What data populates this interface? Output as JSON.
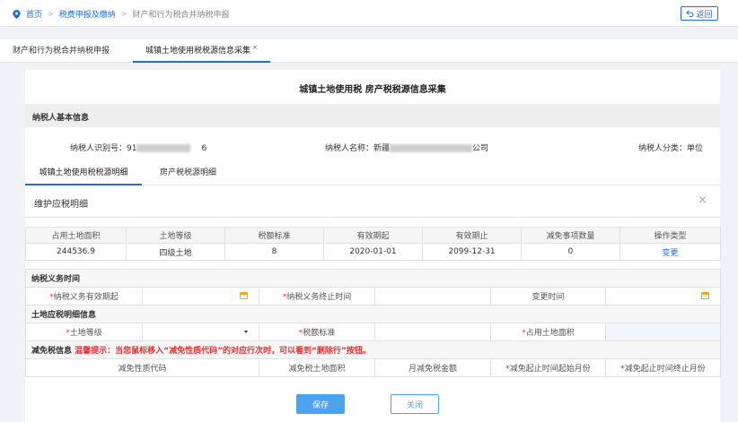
{
  "breadcrumb": {
    "home": "首页",
    "level2": "税费申报及缴纳",
    "level3": "财产和行为税合并纳税申报",
    "back_label": "返回"
  },
  "tabs": [
    {
      "label": "财产和行为税合并纳税申报"
    },
    {
      "label": "城镇土地使用税税源信息采集",
      "close": "×"
    }
  ],
  "page_title": "城镇土地使用税 房产税税源信息采集",
  "taxpayer_section": {
    "title": "纳税人基本信息",
    "id_label": "纳税人识别号：",
    "id_value_prefix": "91",
    "id_value_suffix": "6",
    "name_label": "纳税人名称：",
    "name_value_prefix": "新疆",
    "name_value_suffix": "公司",
    "type_label": "纳税人分类：",
    "type_value": "单位"
  },
  "sub_tabs": [
    "城镇土地使用税税源明细",
    "房产税税源明细"
  ],
  "maintain": {
    "title": "维护应税明细",
    "close": "×"
  },
  "detail_table": {
    "headers": [
      "占用土地面积",
      "土地等级",
      "税额标准",
      "有效期起",
      "有效期止",
      "减免事项数量",
      "操作类型"
    ],
    "rows": [
      {
        "area": "244536.9",
        "grade": "四级土地",
        "rate": "8",
        "start": "2020-01-01",
        "end": "2099-12-31",
        "count": "0",
        "action": "变更"
      }
    ]
  },
  "form": {
    "obligation_title": "纳税义务时间",
    "start_label": "*纳税义务有效期起",
    "end_label": "*纳税义务终止时间",
    "change_label": "变更时间",
    "land_title": "土地应税明细信息",
    "grade_label": "*土地等级",
    "rate_label": "*税额标准",
    "area_label": "*占用土地面积",
    "relief_title": "减免税信息",
    "relief_tip": "温馨提示：当您鼠标移入“减免性质代码”的对应行次时，可以看到“删除行”按钮。",
    "relief_headers": [
      "减免性质代码",
      "减免税土地面积",
      "月减免税金额",
      "*减免起止时间起始月份",
      "*减免起止时间终止月份"
    ]
  },
  "buttons": {
    "save": "保存",
    "close": "关闭"
  },
  "colors": {
    "accent": "#1e6fd9",
    "button": "#4da2f0",
    "warning": "#e83030",
    "date_icon": "#f5a623"
  }
}
